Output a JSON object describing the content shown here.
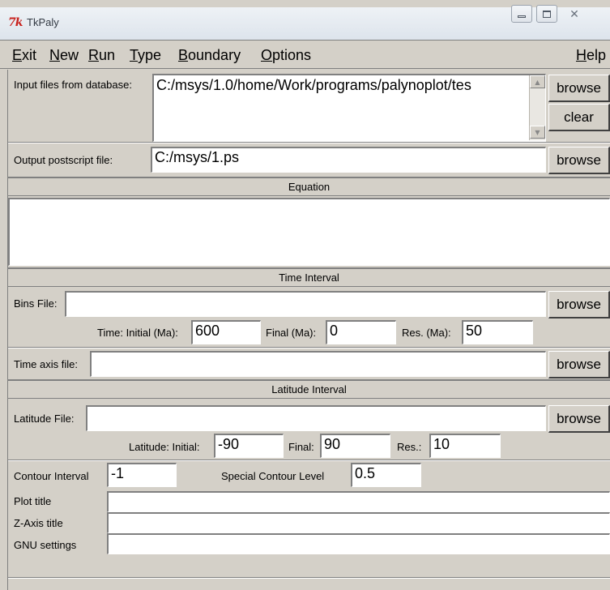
{
  "window": {
    "title": "TkPaly",
    "logo": "7k",
    "controls": [
      "minimize-icon",
      "maximize-icon",
      "close-icon"
    ]
  },
  "menu": {
    "exit": "Exit",
    "new": "New",
    "run": "Run",
    "type": "Type",
    "boundary": "Boundary",
    "options": "Options",
    "help": "Help"
  },
  "input_files": {
    "label": "Input files from database:",
    "value": "C:/msys/1.0/home/Work/programs/palynoplot/tes",
    "browse": "browse",
    "clear": "clear"
  },
  "output_file": {
    "label": "Output postscript file:",
    "value": "C:/msys/1.ps",
    "browse": "browse"
  },
  "equation": {
    "header": "Equation",
    "value": ""
  },
  "time_interval": {
    "header": "Time Interval",
    "bins_label": "Bins File:",
    "bins_value": "",
    "bins_browse": "browse",
    "initial_label": "Time: Initial (Ma):",
    "initial_value": "600",
    "final_label": "Final (Ma):",
    "final_value": "0",
    "res_label": "Res. (Ma):",
    "res_value": "50",
    "axis_label": "Time axis file:",
    "axis_value": "",
    "axis_browse": "browse"
  },
  "latitude_interval": {
    "header": "Latitude Interval",
    "file_label": "Latitude File:",
    "file_value": "",
    "file_browse": "browse",
    "initial_label": "Latitude: Initial:",
    "initial_value": "-90",
    "final_label": "Final:",
    "final_value": "90",
    "res_label": "Res.:",
    "res_value": "10"
  },
  "contour": {
    "interval_label": "Contour Interval",
    "interval_value": "-1",
    "special_label": "Special Contour Level",
    "special_value": "0.5"
  },
  "titles": {
    "plot_label": "Plot title",
    "plot_value": "",
    "zaxis_label": "Z-Axis title",
    "zaxis_value": "",
    "gnu_label": "GNU settings",
    "gnu_value": ""
  }
}
